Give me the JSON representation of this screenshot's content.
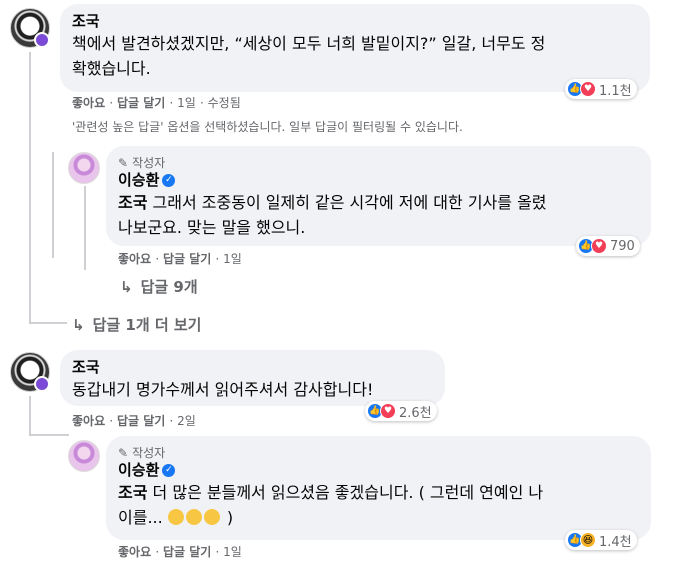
{
  "comments": [
    {
      "author": "조국",
      "text": "책에서 발견하셨겠지만, “세상이 모두 너희 발밑이지?” 일갈, 너무도 정확했습니다.",
      "text_line1": "책에서 발견하셨겠지만, “세상이 모두 너희 발밑이지?” 일갈, 너무도 정",
      "text_line2": "확했습니다.",
      "actions": {
        "like": "좋아요",
        "reply": "답글 달기",
        "time": "1일",
        "edited": "수정됨"
      },
      "reactions": {
        "count": "1.1천",
        "types": [
          "like-icon",
          "love-icon"
        ]
      },
      "filter_note": "'관련성 높은 답글' 옵션을 선택하셨습니다. 일부 답글이 필터링될 수 있습니다.",
      "replies": [
        {
          "author_badge": "작성자",
          "author": "이승환",
          "mention": "조국",
          "text_line1": "그래서 조중동이 일제히 같은 시각에 저에 대한 기사를 올렸",
          "text_line2": "나보군요. 맞는 말을 했으니.",
          "actions": {
            "like": "좋아요",
            "reply": "답글 달기",
            "time": "1일"
          },
          "reactions": {
            "count": "790",
            "types": [
              "like-icon",
              "love-icon"
            ]
          }
        }
      ],
      "more_replies": "답글 9개",
      "see_more": "답글 1개 더 보기"
    },
    {
      "author": "조국",
      "text_line1": "동갑내기 명가수께서 읽어주셔서 감사합니다!",
      "actions": {
        "like": "좋아요",
        "reply": "답글 달기",
        "time": "2일"
      },
      "reactions": {
        "count": "2.6천",
        "types": [
          "like-icon",
          "love-icon"
        ]
      },
      "replies": [
        {
          "author_badge": "작성자",
          "author": "이승환",
          "mention": "조국",
          "text_line1": "더 많은 분들께서 읽으셨음 좋겠습니다. ( 그런데 연예인 나",
          "text_line2_a": "이를...",
          "text_line2_b": ")",
          "actions": {
            "like": "좋아요",
            "reply": "답글 달기",
            "time": "1일"
          },
          "reactions": {
            "count": "1.4천",
            "types": [
              "like-icon",
              "haha-icon"
            ]
          }
        }
      ]
    }
  ],
  "colors": {
    "bubble": "#f0f2f5",
    "meta": "#65676b",
    "like": "#1877f2",
    "love": "#f33e58",
    "haha": "#f7b125"
  }
}
